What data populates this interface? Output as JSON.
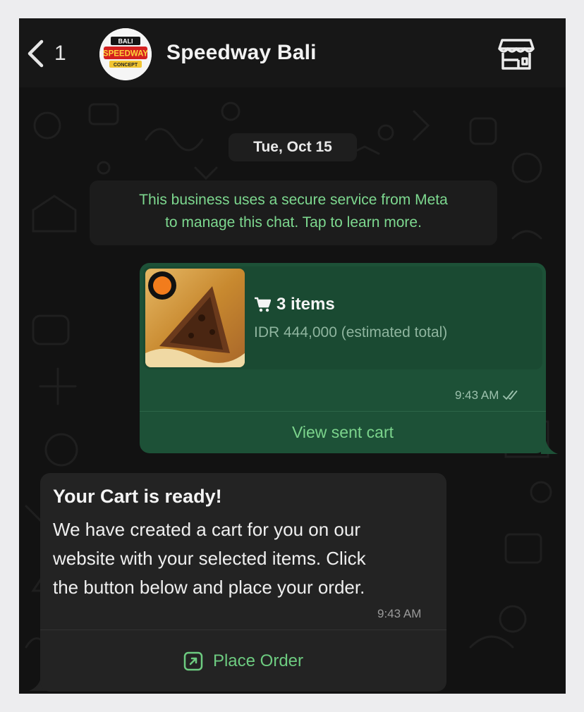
{
  "header": {
    "back_count": "1",
    "contact_name": "Speedway Bali",
    "avatar_logo": {
      "top": "BALI",
      "main": "SPEEDWAY",
      "bottom": "CONCEPT"
    },
    "back_icon": "chevron-left-icon",
    "store_icon": "storefront-icon"
  },
  "chat": {
    "date_label": "Tue, Oct 15",
    "notice_line1": "This business uses a secure service from Meta",
    "notice_line2": "to manage this chat. Tap to learn more.",
    "sent_cart": {
      "items_label": "3 items",
      "total_label": "IDR 444,000 (estimated total)",
      "time": "9:43 AM",
      "status_icon": "double-check-icon",
      "action_label": "View sent cart"
    },
    "received": {
      "title": "Your Cart is ready!",
      "body_line1": "We have created a cart for you on our",
      "body_line2": "website with your selected items. Click",
      "body_line3": "the button below and place your order.",
      "time": "9:43 AM",
      "action_label": "Place Order",
      "action_icon": "external-link-icon"
    }
  },
  "colors": {
    "sent_bubble": "#1d5137",
    "received_bubble": "#232323",
    "accent_green": "#7bd48c",
    "background": "#0b0b0b"
  }
}
